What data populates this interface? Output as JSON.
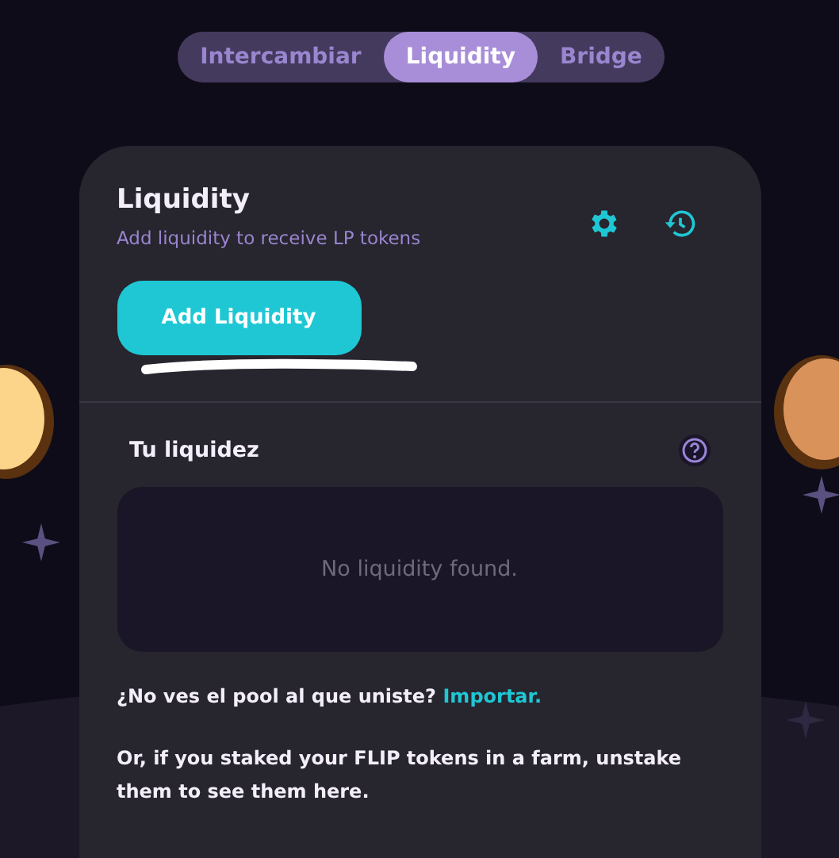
{
  "tabs": [
    {
      "label": "Intercambiar",
      "selected": false
    },
    {
      "label": "Liquidity",
      "selected": true
    },
    {
      "label": "Bridge",
      "selected": false
    }
  ],
  "card": {
    "title": "Liquidity",
    "subtitle": "Add liquidity to receive LP tokens",
    "add_button": "Add Liquidity",
    "section_title": "Tu liquidez",
    "empty_text": "No liquidity found.",
    "import_prompt": {
      "text": "¿No ves el pool al que uniste?",
      "link": "Importar."
    },
    "farm_note": "Or, if you staked your FLIP tokens in a farm, unstake them to see them here."
  }
}
